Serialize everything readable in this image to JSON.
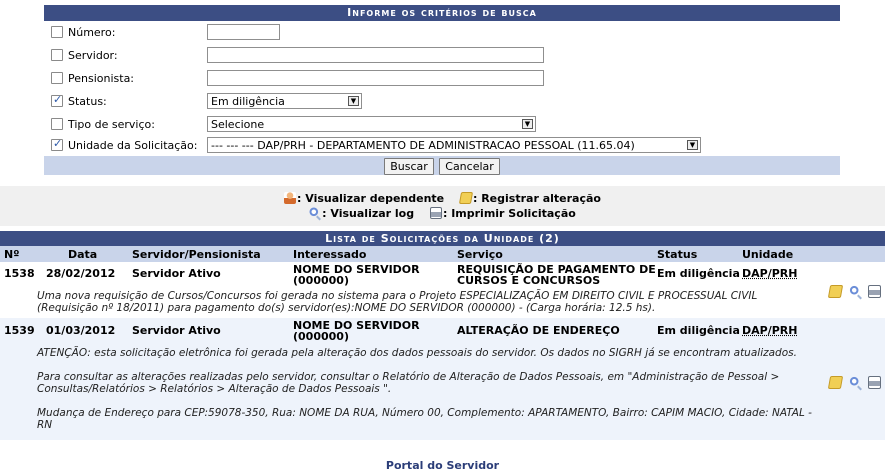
{
  "search": {
    "title": "Informe os critérios de busca",
    "fields": {
      "numero": {
        "label": "Número:",
        "checked": false,
        "value": ""
      },
      "servidor": {
        "label": "Servidor:",
        "checked": false,
        "value": ""
      },
      "pensionista": {
        "label": "Pensionista:",
        "checked": false,
        "value": ""
      },
      "status": {
        "label": "Status:",
        "checked": true,
        "value": "Em diligência"
      },
      "tipo": {
        "label": "Tipo de serviço:",
        "checked": false,
        "value": "Selecione"
      },
      "unidade": {
        "label": "Unidade da Solicitação:",
        "checked": true,
        "value": "--- --- --- DAP/PRH - DEPARTAMENTO DE ADMINISTRACAO PESSOAL (11.65.04)"
      }
    },
    "buttons": {
      "buscar": "Buscar",
      "cancelar": "Cancelar"
    }
  },
  "legend": {
    "visualizar_dependente": ": Visualizar dependente",
    "registrar_alteracao": ": Registrar alteração",
    "visualizar_log": ": Visualizar log",
    "imprimir": ": Imprimir Solicitação"
  },
  "list": {
    "title": "Lista de Solicitações da Unidade (2)",
    "headers": {
      "num": "Nº",
      "data": "Data",
      "servidor": "Servidor/Pensionista",
      "interessado": "Interessado",
      "servico": "Serviço",
      "status": "Status",
      "unidade": "Unidade"
    },
    "rows": [
      {
        "num": "1538",
        "data": "28/02/2012",
        "servidor": "Servidor Ativo",
        "interessado_1": "NOME DO SERVIDOR",
        "interessado_2": "(000000)",
        "servico_1": "REQUISIÇÃO DE PAGAMENTO DE",
        "servico_2": "CURSOS E CONCURSOS",
        "status": "Em diligência",
        "unidade": "DAP/PRH",
        "desc_1": "Uma nova requisição de Cursos/Concursos foi gerada no sistema para o Projeto ESPECIALIZAÇÃO EM DIREITO CIVIL E PROCESSUAL CIVIL",
        "desc_2": "(Requisição nº 18/2011) para pagamento do(s) servidor(es):NOME DO SERVIDOR (000000) - (Carga horária: 12.5 hs)."
      },
      {
        "num": "1539",
        "data": "01/03/2012",
        "servidor": "Servidor Ativo",
        "interessado_1": "NOME DO SERVIDOR",
        "interessado_2": "(000000)",
        "servico_1": "ALTERAÇÃO DE ENDEREÇO",
        "servico_2": "",
        "status": "Em diligência",
        "unidade": "DAP/PRH",
        "desc_1": "ATENÇÃO: esta solicitação eletrônica foi gerada pela alteração dos dados pessoais do servidor. Os dados no SIGRH já se encontram atualizados.",
        "desc_2": "Para consultar as alterações realizadas pelo servidor, consultar o Relatório de Alteração de Dados Pessoais, em \"Administração de Pessoal >",
        "desc_3": "Consultas/Relatórios > Relatórios > Alteração de Dados Pessoais \".",
        "desc_4": "Mudança de Endereço para CEP:59078-350, Rua: NOME DA RUA, Número 00, Complemento: APARTAMENTO, Bairro: CAPIM MACIO, Cidade: NATAL -",
        "desc_5": "RN"
      }
    ]
  },
  "footer": {
    "portal": "Portal do Servidor"
  },
  "colors": {
    "header_bg": "#3c4e84",
    "subheader_bg": "#c9d4ea",
    "row_alt": "#eef3fb"
  }
}
